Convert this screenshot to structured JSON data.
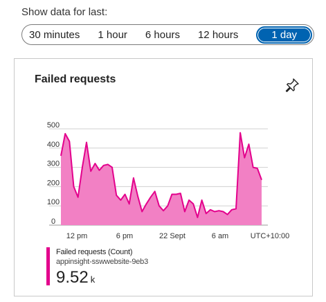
{
  "time_range": {
    "label": "Show data for last:",
    "options": [
      "30 minutes",
      "1 hour",
      "6 hours",
      "12 hours",
      "1 day"
    ],
    "selected": "1 day"
  },
  "tile": {
    "title": "Failed requests",
    "pin_icon": "pin-icon"
  },
  "colors": {
    "series": "#e3008c",
    "area": "#f280c4",
    "selected": "#0063b1"
  },
  "legend": {
    "name": "Failed requests (Count)",
    "resource": "appinsight-sswwebsite-9eb3",
    "value": "9.52",
    "unit": "k"
  },
  "chart_data": {
    "type": "area",
    "y_ticks": [
      "500",
      "400",
      "300",
      "200",
      "100",
      "0"
    ],
    "ylim": [
      0,
      500
    ],
    "x_ticks": [
      "12 pm",
      "6 pm",
      "22 Sept",
      "6 am",
      "UTC+10:00"
    ],
    "grid": true,
    "series": [
      {
        "name": "Failed requests (Count)",
        "values": [
          360,
          475,
          435,
          200,
          145,
          300,
          430,
          280,
          320,
          285,
          310,
          315,
          300,
          155,
          130,
          160,
          110,
          245,
          150,
          70,
          110,
          145,
          175,
          100,
          75,
          100,
          160,
          160,
          165,
          70,
          130,
          110,
          40,
          130,
          60,
          80,
          70,
          75,
          70,
          55,
          80,
          85,
          480,
          350,
          420,
          300,
          295,
          235
        ]
      }
    ]
  }
}
